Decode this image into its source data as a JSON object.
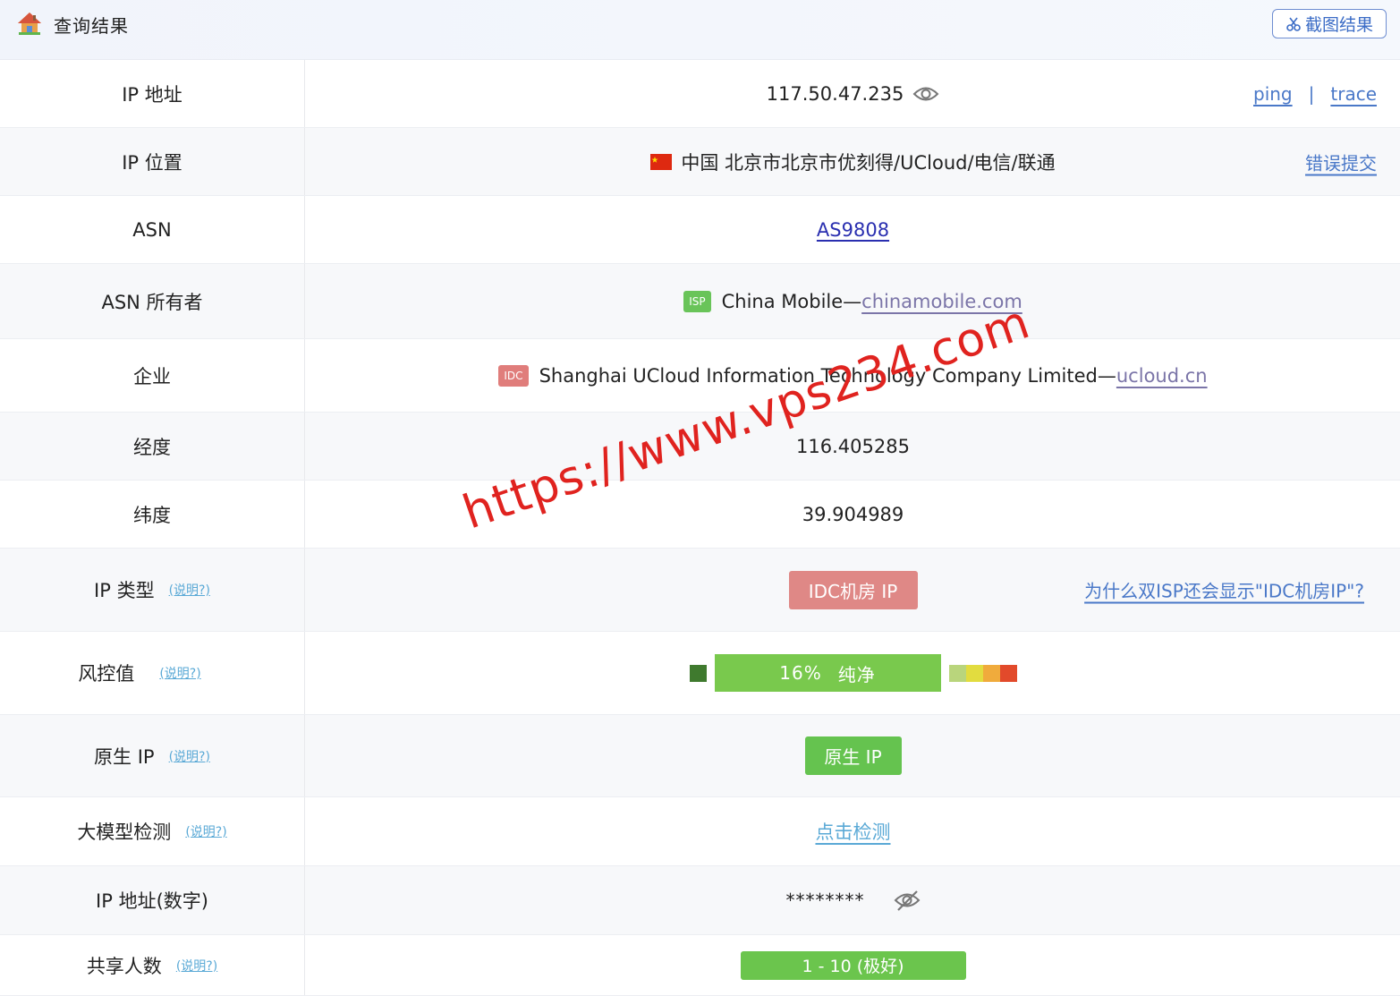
{
  "header": {
    "title": "查询结果",
    "screenshot_button": "截图结果"
  },
  "rows": {
    "ip": {
      "label": "IP 地址",
      "value": "117.50.47.235",
      "ping": "ping",
      "separator": "|",
      "trace": "trace"
    },
    "location": {
      "label": "IP 位置",
      "value": "中国 北京市北京市优刻得/UCloud/电信/联通",
      "report": "错误提交"
    },
    "asn": {
      "label": "ASN",
      "value": "AS9808"
    },
    "asn_owner": {
      "label": "ASN 所有者",
      "tag": "ISP",
      "name": "China Mobile—",
      "domain": "chinamobile.com"
    },
    "company": {
      "label": "企业",
      "tag": "IDC",
      "name": "Shanghai UCloud Information Technology Company Limited—",
      "domain": "ucloud.cn"
    },
    "longitude": {
      "label": "经度",
      "value": "116.405285"
    },
    "latitude": {
      "label": "纬度",
      "value": "39.904989"
    },
    "ip_type": {
      "label": "IP 类型",
      "help": "(说明?)",
      "value": "IDC机房 IP",
      "why": "为什么双ISP还会显示\"IDC机房IP\"?"
    },
    "risk": {
      "label": "风控值",
      "help": "(说明?)",
      "value": "16%",
      "level": "纯净",
      "percent": 16
    },
    "native": {
      "label": "原生 IP",
      "help": "(说明?)",
      "value": "原生 IP"
    },
    "llm": {
      "label": "大模型检测",
      "help": "(说明?)",
      "value": "点击检测"
    },
    "ip_numeric": {
      "label": "IP 地址(数字)",
      "value": "********"
    },
    "shared": {
      "label": "共享人数",
      "help": "(说明?)",
      "value": "1 - 10 (极好)"
    }
  },
  "colors": {
    "accent_link": "#4a78c8",
    "idc_red": "#df8886",
    "green": "#6bc54d",
    "risk_scale": [
      "#b9d57c",
      "#e2dc3f",
      "#f0ab3c",
      "#e24a2b"
    ]
  },
  "watermark": "https://www.vps234.com"
}
